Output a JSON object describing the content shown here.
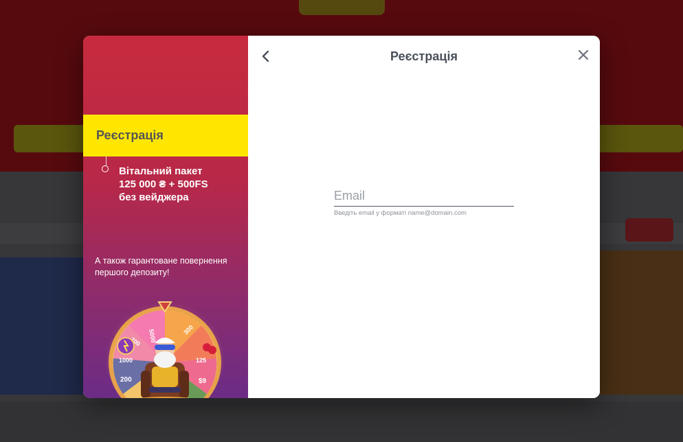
{
  "modal": {
    "promo": {
      "step_label": "Реєстрація",
      "offer_lines": [
        "Вітальний пакет",
        "125 000 ₴ + 500FS",
        "без вейджера"
      ],
      "bonus_text": "А також гарантоване повернення першого депозиту!",
      "wheel_numbers": [
        "5000",
        "700",
        "1000",
        "200",
        "300",
        "125",
        "$9"
      ]
    },
    "form": {
      "title": "Реєстрація",
      "email_placeholder": "Email",
      "email_value": "",
      "email_hint": "Введіть email у форматі name@domain.com"
    }
  },
  "colors": {
    "accent_yellow": "#ffe600",
    "promo_top": "#c72a3e",
    "promo_bottom": "#6b2c86",
    "title_text": "#4a4f5a"
  },
  "icons": {
    "back": "chevron-left-icon",
    "close": "close-icon"
  }
}
